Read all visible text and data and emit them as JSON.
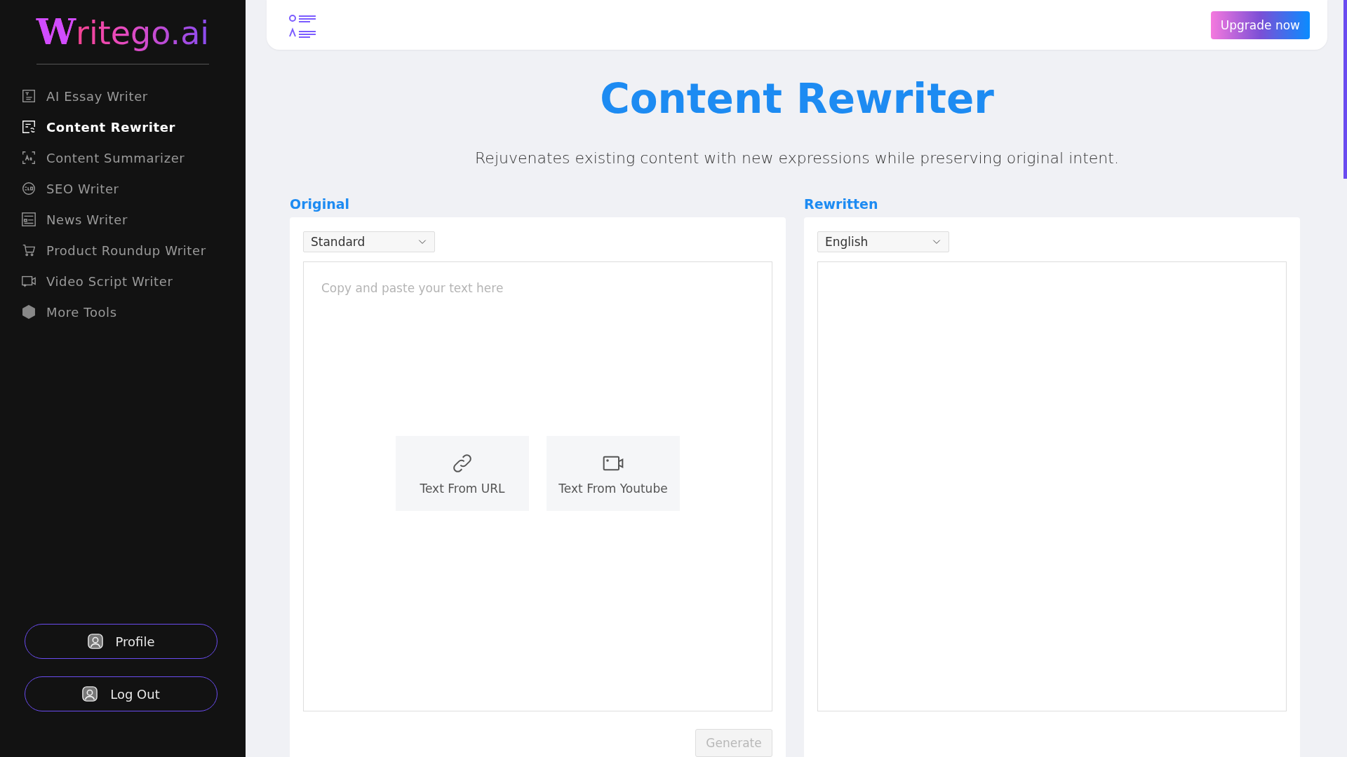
{
  "sidebar": {
    "logo": {
      "initial": "W",
      "rest": "ritego.ai"
    },
    "items": [
      {
        "label": "AI Essay Writer",
        "selected": false
      },
      {
        "label": "Content Rewriter",
        "selected": true
      },
      {
        "label": "Content Summarizer",
        "selected": false
      },
      {
        "label": "SEO Writer",
        "selected": false
      },
      {
        "label": "News Writer",
        "selected": false
      },
      {
        "label": "Product Roundup Writer",
        "selected": false
      },
      {
        "label": "Video Script Writer",
        "selected": false
      },
      {
        "label": "More Tools",
        "selected": false
      }
    ],
    "buttons": [
      {
        "label": "Profile"
      },
      {
        "label": "Log Out"
      }
    ]
  },
  "header": {
    "upgrade_button": "Upgrade now"
  },
  "title": "Content Rewriter",
  "subtitle": "Rejuvenates existing content with new expressions while preserving original intent.",
  "original": {
    "label": "Original",
    "mode": "Standard",
    "placeholder": "Copy and paste your text here",
    "sources": [
      {
        "label": "Text From URL"
      },
      {
        "label": "Text From Youtube"
      }
    ],
    "generate": {
      "label": "Generate",
      "disabled": true
    }
  },
  "rewritten": {
    "label": "Rewritten",
    "language": "English"
  }
}
